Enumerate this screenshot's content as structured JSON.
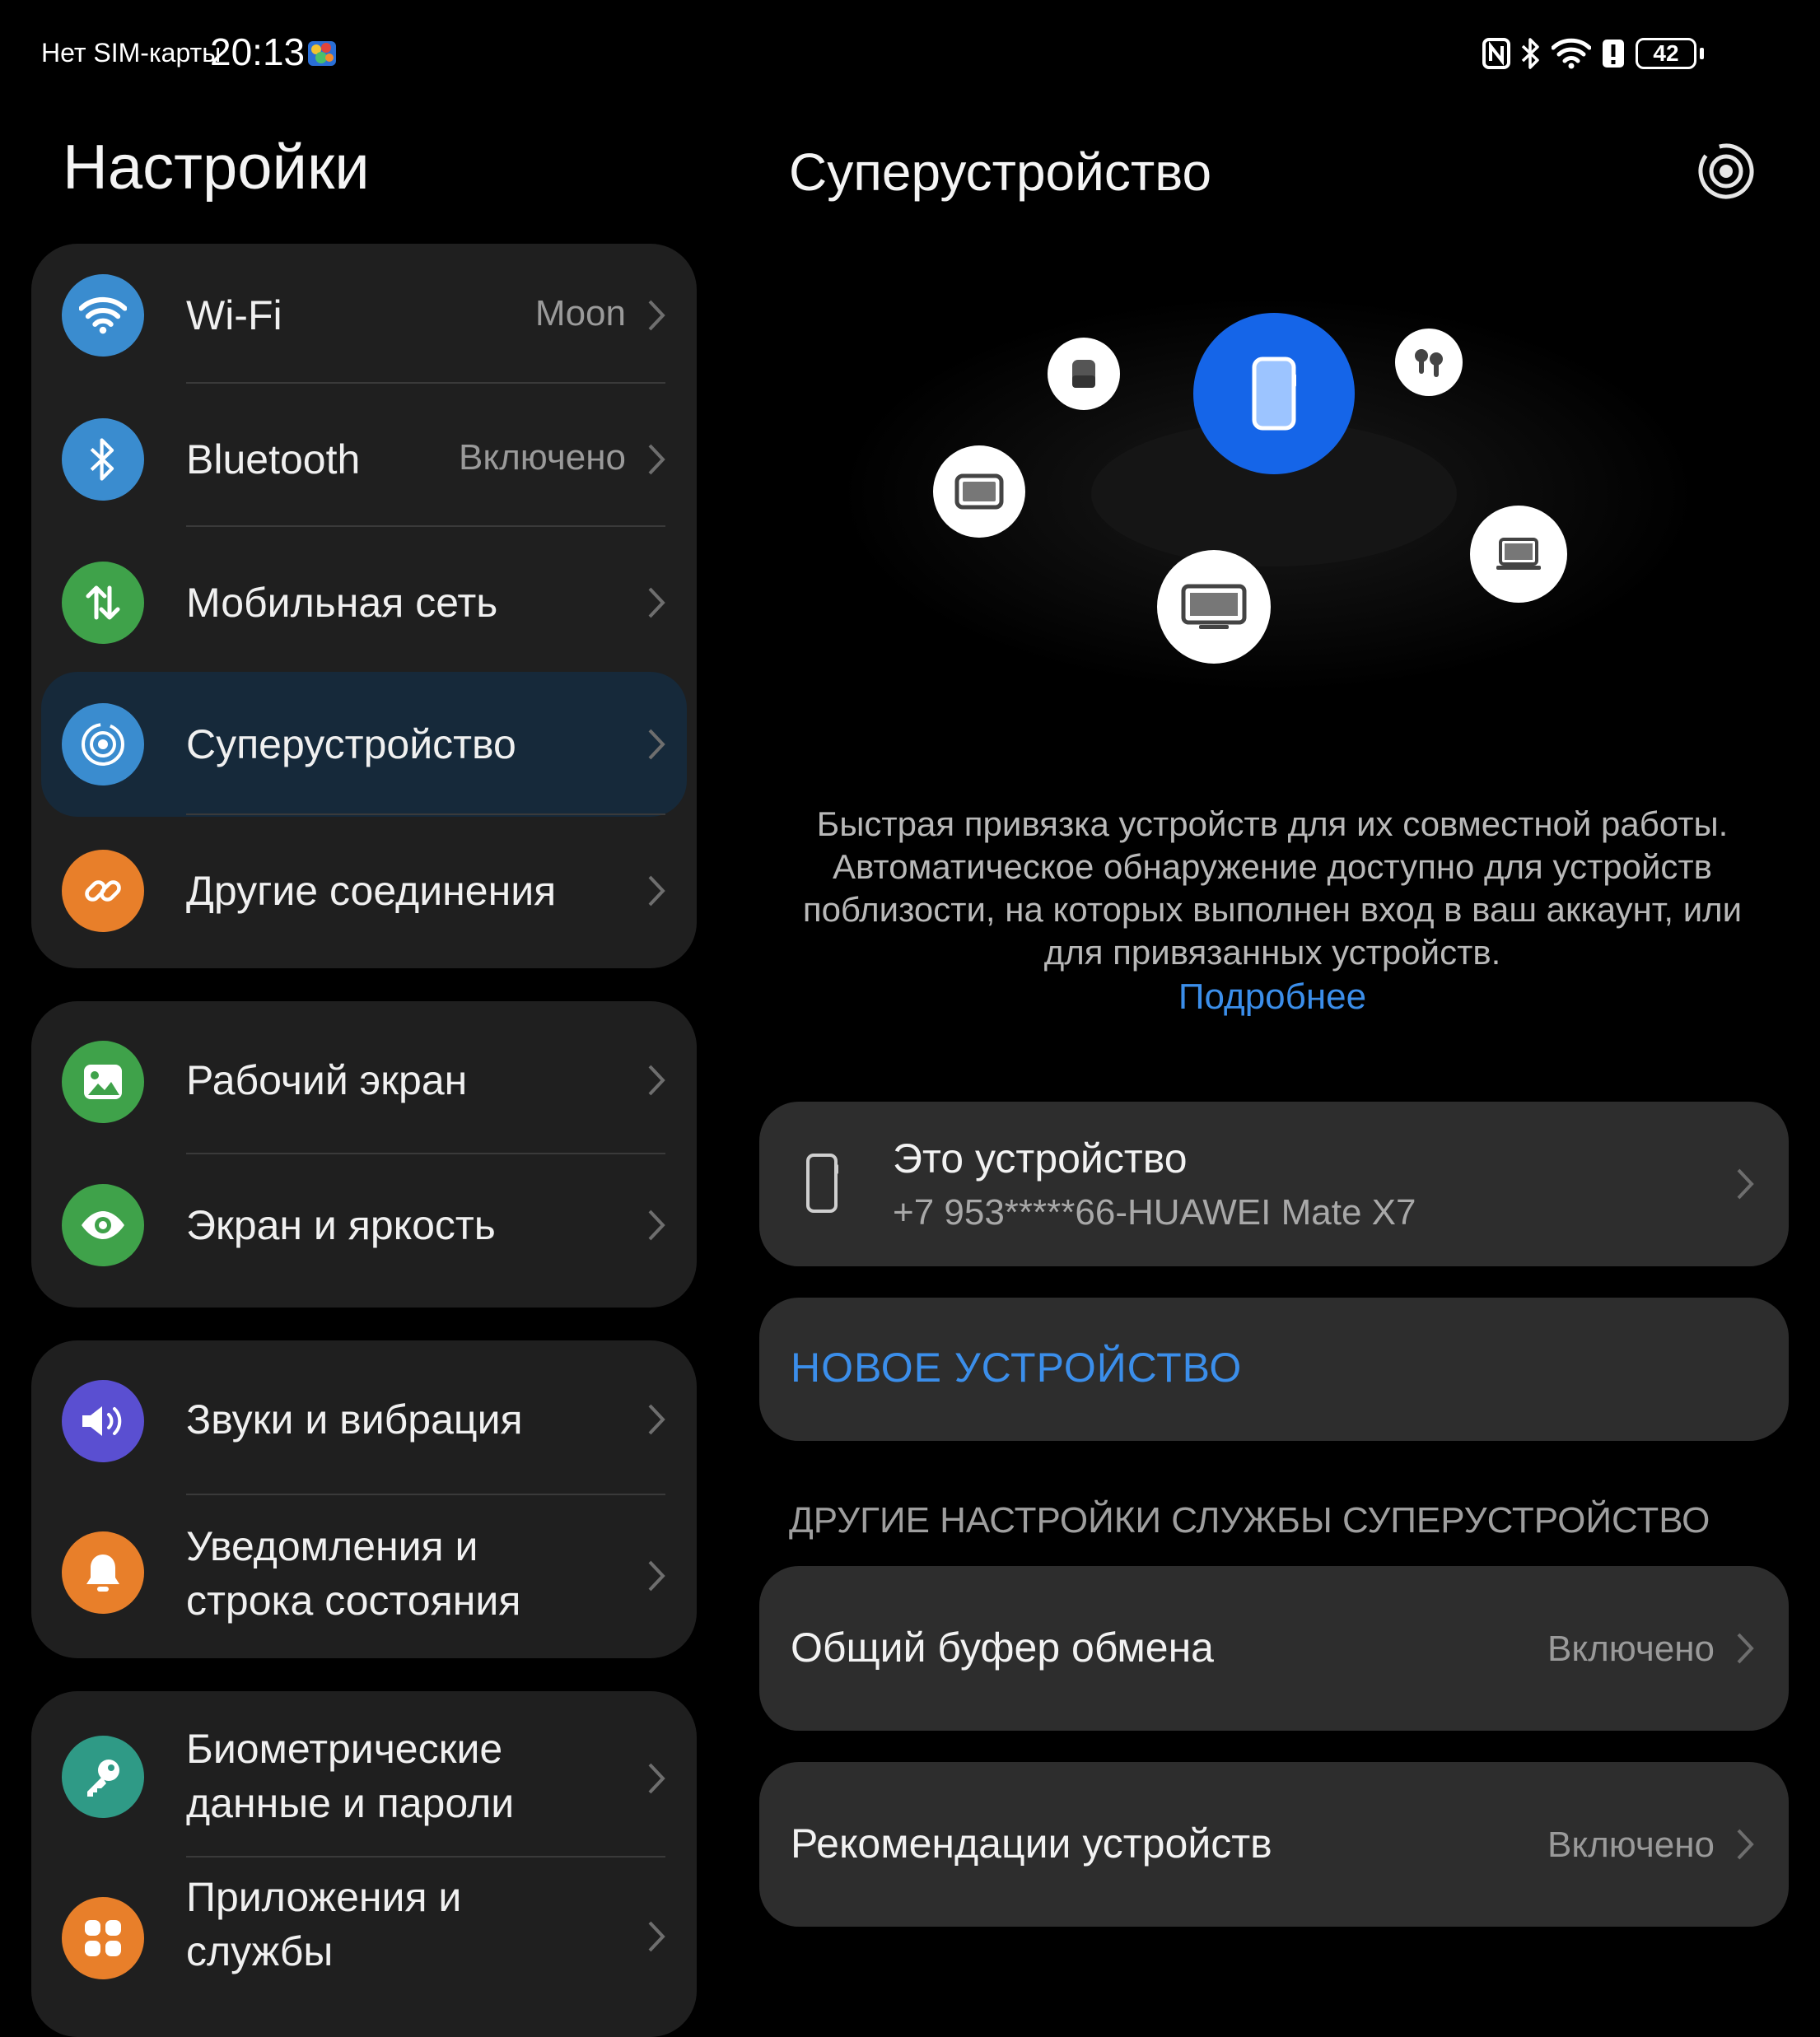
{
  "status_bar": {
    "sim": "Нет SIM-карты",
    "time": "20:13",
    "battery": "42",
    "icons": [
      "nfc-icon",
      "bluetooth-icon",
      "wifi-icon",
      "alert-icon",
      "battery-icon"
    ]
  },
  "settings": {
    "title": "Настройки",
    "groups": [
      {
        "items": [
          {
            "label": "Wi-Fi",
            "value": "Moon",
            "icon": "wifi-icon",
            "color": "#3a8ccf"
          },
          {
            "label": "Bluetooth",
            "value": "Включено",
            "icon": "bluetooth-icon",
            "color": "#3a8ccf"
          },
          {
            "label": "Мобильная сеть",
            "value": "",
            "icon": "mobile-data-icon",
            "color": "#3fa24a"
          },
          {
            "label": "Суперустройство",
            "value": "",
            "icon": "super-device-icon",
            "color": "#3a8ccf",
            "selected": true
          },
          {
            "label": "Другие соединения",
            "value": "",
            "icon": "link-icon",
            "color": "#e87f2a"
          }
        ]
      },
      {
        "items": [
          {
            "label": "Рабочий экран",
            "value": "",
            "icon": "wallpaper-icon",
            "color": "#3fa24a"
          },
          {
            "label": "Экран и яркость",
            "value": "",
            "icon": "eye-icon",
            "color": "#3fa24a"
          }
        ]
      },
      {
        "items": [
          {
            "label": "Звуки и вибрация",
            "value": "",
            "icon": "sound-icon",
            "color": "#5a4fd1"
          },
          {
            "label": "Уведомления и строка состояния",
            "label_lines": [
              "Уведомления и",
              "строка состояния"
            ],
            "value": "",
            "icon": "bell-icon",
            "color": "#e87f2a"
          }
        ]
      },
      {
        "items": [
          {
            "label": "Биометрические данные и пароли",
            "label_lines": [
              "Биометрические",
              "данные и пароли"
            ],
            "value": "",
            "icon": "key-icon",
            "color": "#2f9a86"
          },
          {
            "label": "Приложения и службы",
            "label_lines": [
              "Приложения и",
              "службы"
            ],
            "value": "",
            "icon": "apps-icon",
            "color": "#e87f2a"
          }
        ]
      }
    ]
  },
  "super_device": {
    "title": "Суперустройство",
    "hero_devices": [
      "phone-icon",
      "speaker-icon",
      "earbuds-icon",
      "tablet-icon",
      "laptop-icon",
      "tv-icon"
    ],
    "description": "Быстрая привязка устройств для их совместной работы. Автоматическое обнаружение доступно для устройств поблизости, на которых выполнен вход в ваш аккаунт, или для привязанных устройств.",
    "learn_more": "Подробнее",
    "this_device": {
      "title": "Это устройство",
      "subtitle": "+7 953*****66-HUAWEI Mate X7"
    },
    "new_device": "НОВОЕ УСТРОЙСТВО",
    "section_header": "ДРУГИЕ НАСТРОЙКИ СЛУЖБЫ СУПЕРУСТРОЙСТВО",
    "options": [
      {
        "label": "Общий буфер обмена",
        "value": "Включено"
      },
      {
        "label": "Рекомендации устройств",
        "value": "Включено"
      }
    ]
  },
  "colors": {
    "accent_blue": "#3b8eea",
    "hub_blue": "#1565e8",
    "card_bg": "#1f1f1f",
    "selected_bg": "#16293a"
  }
}
